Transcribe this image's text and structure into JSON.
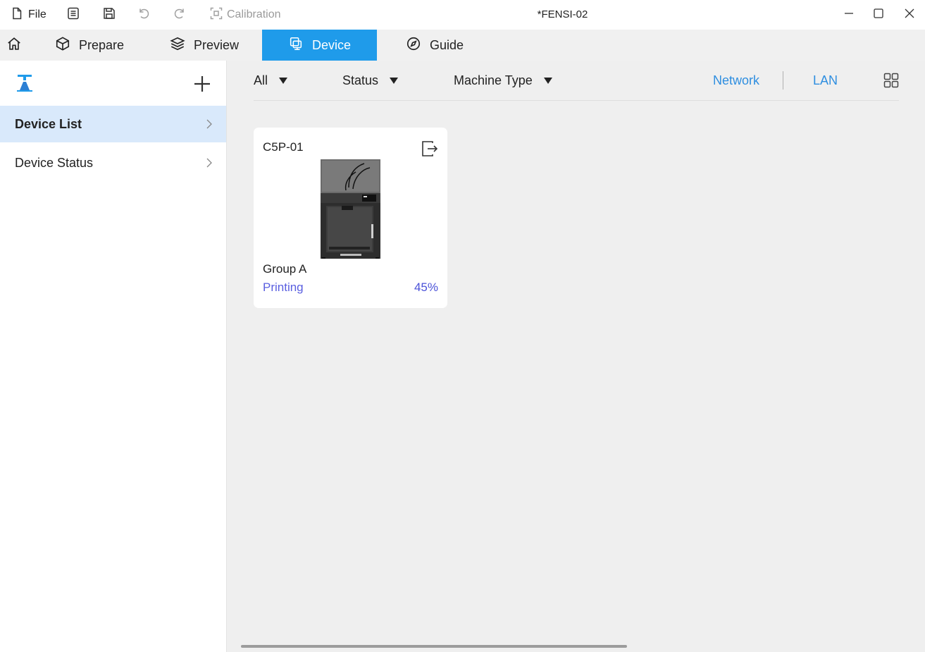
{
  "titlebar": {
    "file_label": "File",
    "calibration_label": "Calibration",
    "window_title": "*FENSI-02"
  },
  "tabs": {
    "prepare": "Prepare",
    "preview": "Preview",
    "device": "Device",
    "guide": "Guide"
  },
  "sidebar": {
    "items": [
      {
        "label": "Device List"
      },
      {
        "label": "Device Status"
      }
    ]
  },
  "filters": {
    "all": "All",
    "status": "Status",
    "machine_type": "Machine Type",
    "network": "Network",
    "lan": "LAN"
  },
  "device_card": {
    "name": "C5P-01",
    "group": "Group A",
    "state": "Printing",
    "progress": "45%"
  },
  "colors": {
    "accent": "#1f9bea",
    "link": "#2e8ee0",
    "status": "#5a5fe0",
    "active_row": "#d9e9fb"
  }
}
